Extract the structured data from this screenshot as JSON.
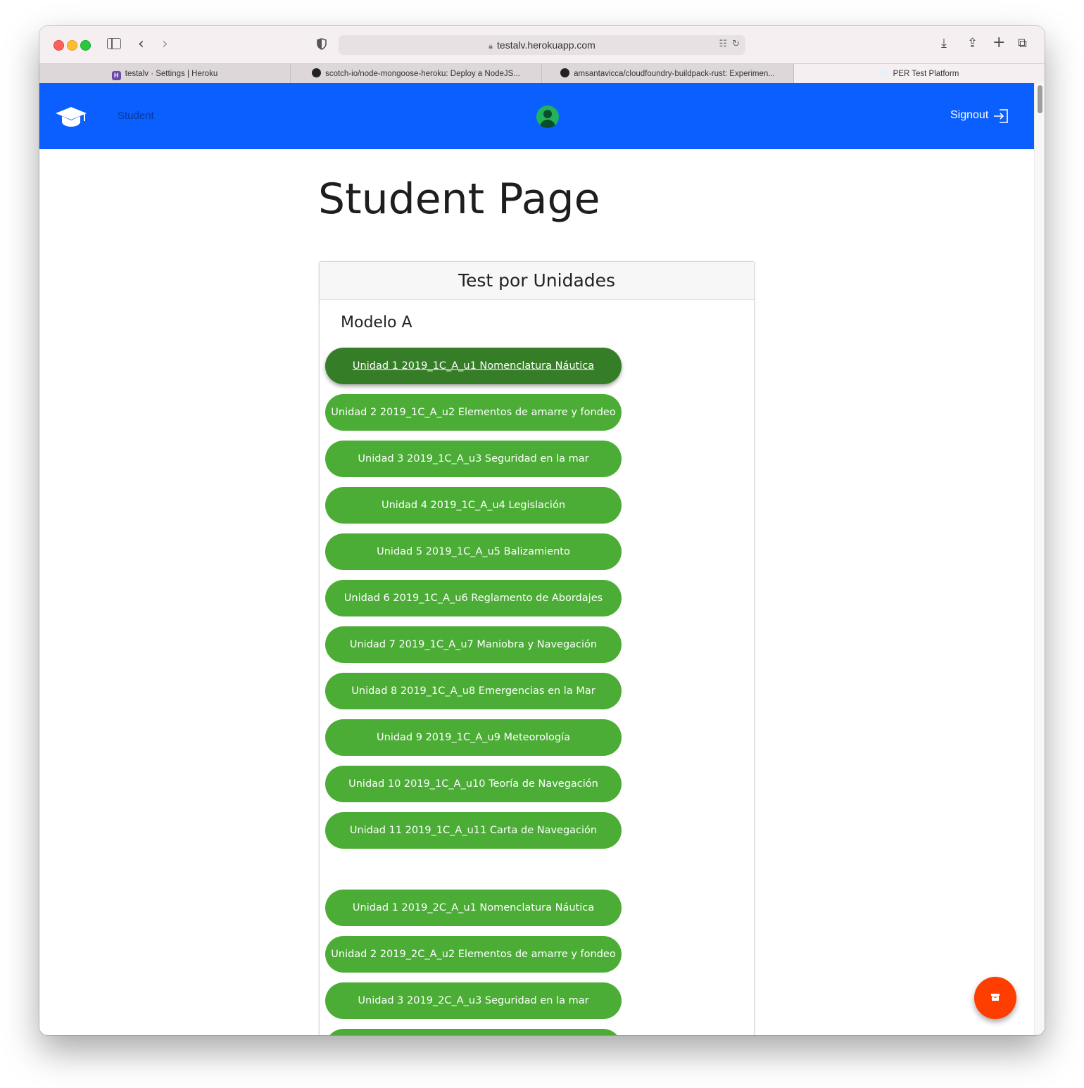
{
  "browser": {
    "url": "testalv.herokuapp.com",
    "tabs": [
      {
        "label": "testalv · Settings | Heroku",
        "icon": "heroku-icon"
      },
      {
        "label": "scotch-io/node-mongoose-heroku: Deploy a NodeJS...",
        "icon": "github-icon"
      },
      {
        "label": "amsantavicca/cloudfoundry-buildpack-rust: Experimen...",
        "icon": "github-icon"
      },
      {
        "label": "PER Test Platform",
        "icon": "per-icon",
        "active": true
      }
    ]
  },
  "navbar": {
    "brand_icon": "graduation-cap-icon",
    "student_label": "Student",
    "signout_label": "Signout",
    "bg_color": "#0b5ffe"
  },
  "page": {
    "title": "Student Page"
  },
  "card": {
    "header": "Test por Unidades",
    "section_title": "Modelo A",
    "buttons": [
      {
        "label": "Unidad 1 2019_1C_A_u1 Nomenclatura Náutica",
        "selected": true
      },
      {
        "label": "Unidad 2 2019_1C_A_u2 Elementos de amarre y fondeo"
      },
      {
        "label": "Unidad 3 2019_1C_A_u3 Seguridad en la mar"
      },
      {
        "label": "Unidad 4 2019_1C_A_u4 Legislación"
      },
      {
        "label": "Unidad 5 2019_1C_A_u5 Balizamiento"
      },
      {
        "label": "Unidad 6 2019_1C_A_u6 Reglamento de Abordajes"
      },
      {
        "label": "Unidad 7 2019_1C_A_u7 Maniobra y Navegación"
      },
      {
        "label": "Unidad 8 2019_1C_A_u8 Emergencias en la Mar"
      },
      {
        "label": "Unidad 9 2019_1C_A_u9 Meteorología"
      },
      {
        "label": "Unidad 10 2019_1C_A_u10 Teoría de Navegación"
      },
      {
        "label": "Unidad 11 2019_1C_A_u11 Carta de Navegación"
      },
      {
        "label": "Unidad 1 2019_2C_A_u1 Nomenclatura Náutica"
      },
      {
        "label": "Unidad 2 2019_2C_A_u2 Elementos de amarre y fondeo"
      },
      {
        "label": "Unidad 3 2019_2C_A_u3 Seguridad en la mar"
      },
      {
        "label": ""
      }
    ],
    "button_color": "#4bad35",
    "selected_color": "#367d27"
  },
  "fab": {
    "icon": "archive-box-icon",
    "color": "#fe3d00"
  }
}
